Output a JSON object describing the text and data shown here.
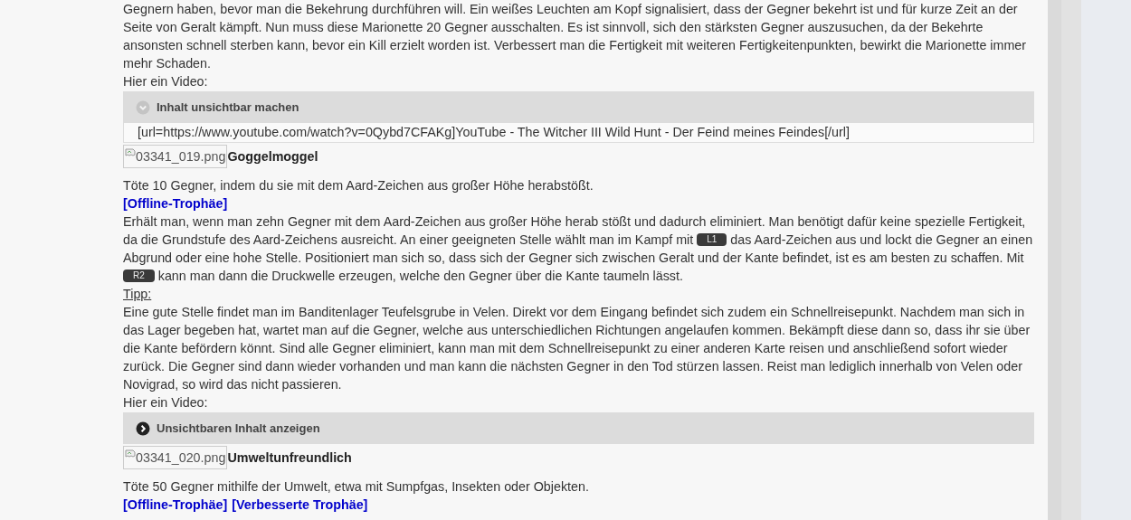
{
  "article": [
    {
      "kind": "paragraph",
      "segments": [
        {
          "kind": "text",
          "text": "Gegnern haben, bevor man die Bekehrung durchführen will. Ein weißes Leuchten am Kopf signalisiert, dass der Gegner bekehrt ist und für kurze Zeit an der Seite von Geralt kämpft. Nun muss diese Marionette 20 Gegner ausschalten. Es ist sinnvoll, sich den stärksten Gegner auszusuchen, da der Bekehrte ansonsten schnell sterben kann, bevor ein Kill erzielt worden ist. Verbessert man die Fertigkeit mit weiteren Fertigkeitenpunkten, bewirkt die Marionette immer mehr Schaden."
        }
      ]
    },
    {
      "kind": "line",
      "text": "Hier ein Video:"
    },
    {
      "kind": "spoiler",
      "header": "Inhalt unsichtbar machen",
      "expanded": true,
      "body": "[url=https://www.youtube.com/watch?v=0Qybd7CFAKg]YouTube - The Witcher III Wild Hunt - Der Feind meines Feindes[/url]"
    },
    {
      "kind": "trophy",
      "image_alt": "03341_019.png",
      "title": "Goggelmoggel"
    },
    {
      "kind": "line",
      "text": "Töte 10 Gegner, indem du sie mit dem Aard-Zeichen aus großer Höhe herabstößt."
    },
    {
      "kind": "links",
      "links": [
        "[Offline-Trophäe]"
      ]
    },
    {
      "kind": "paragraph",
      "segments": [
        {
          "kind": "text",
          "text": "Erhält man, wenn man zehn Gegner mit dem Aard-Zeichen aus großer Höhe herab stößt und dadurch eliminiert. Man benötigt dafür keine spezielle Fertigkeit, da die Grundstufe des Aard-Zeichens ausreicht. An einer geeigneten Stelle wählt man im Kampf mit "
        },
        {
          "kind": "key",
          "text": "L1"
        },
        {
          "kind": "text",
          "text": " das Aard-Zeichen aus und lockt die Gegner an einen Abgrund oder eine hohe Stelle. Positioniert man sich so, dass sich der Gegner sich zwischen Geralt und der Kante befindet, ist es am besten zu schaffen. Mit "
        },
        {
          "kind": "key",
          "text": "R2"
        },
        {
          "kind": "text",
          "text": " kann man dann die Druckwelle erzeugen, welche den Gegner über die Kante taumeln lässt."
        }
      ]
    },
    {
      "kind": "tip",
      "text": "Tipp:"
    },
    {
      "kind": "paragraph",
      "segments": [
        {
          "kind": "text",
          "text": "Eine gute Stelle findet man im Banditenlager Teufelsgrube in Velen. Direkt vor dem Eingang befindet sich zudem ein Schnellreisepunkt. Nachdem man sich in das Lager begeben hat, wartet man auf die Gegner, welche aus unterschiedlichen Richtungen angelaufen kommen. Bekämpft diese dann so, dass ihr sie über die Kante befördern könnt. Sind alle Gegner eliminiert, kann man mit dem Schnellreisepunkt zu einer anderen Karte reisen und anschließend sofort wieder zurück. Die Gegner sind dann wieder vorhanden und man kann die nächsten Gegner in den Tod stürzen lassen. Reist man lediglich innerhalb von Velen oder Novigrad, so wird das nicht passieren."
        }
      ]
    },
    {
      "kind": "line",
      "text": "Hier ein Video:"
    },
    {
      "kind": "spoiler",
      "header": "Unsichtbaren Inhalt anzeigen",
      "expanded": false
    },
    {
      "kind": "trophy",
      "image_alt": "03341_020.png",
      "title": "Umweltunfreundlich"
    },
    {
      "kind": "line",
      "text": "Töte 50 Gegner mithilfe der Umwelt, etwa mit Sumpfgas, Insekten oder Objekten."
    },
    {
      "kind": "links",
      "links": [
        "[Offline-Trophäe]",
        "[Verbesserte Trophäe]"
      ]
    }
  ]
}
